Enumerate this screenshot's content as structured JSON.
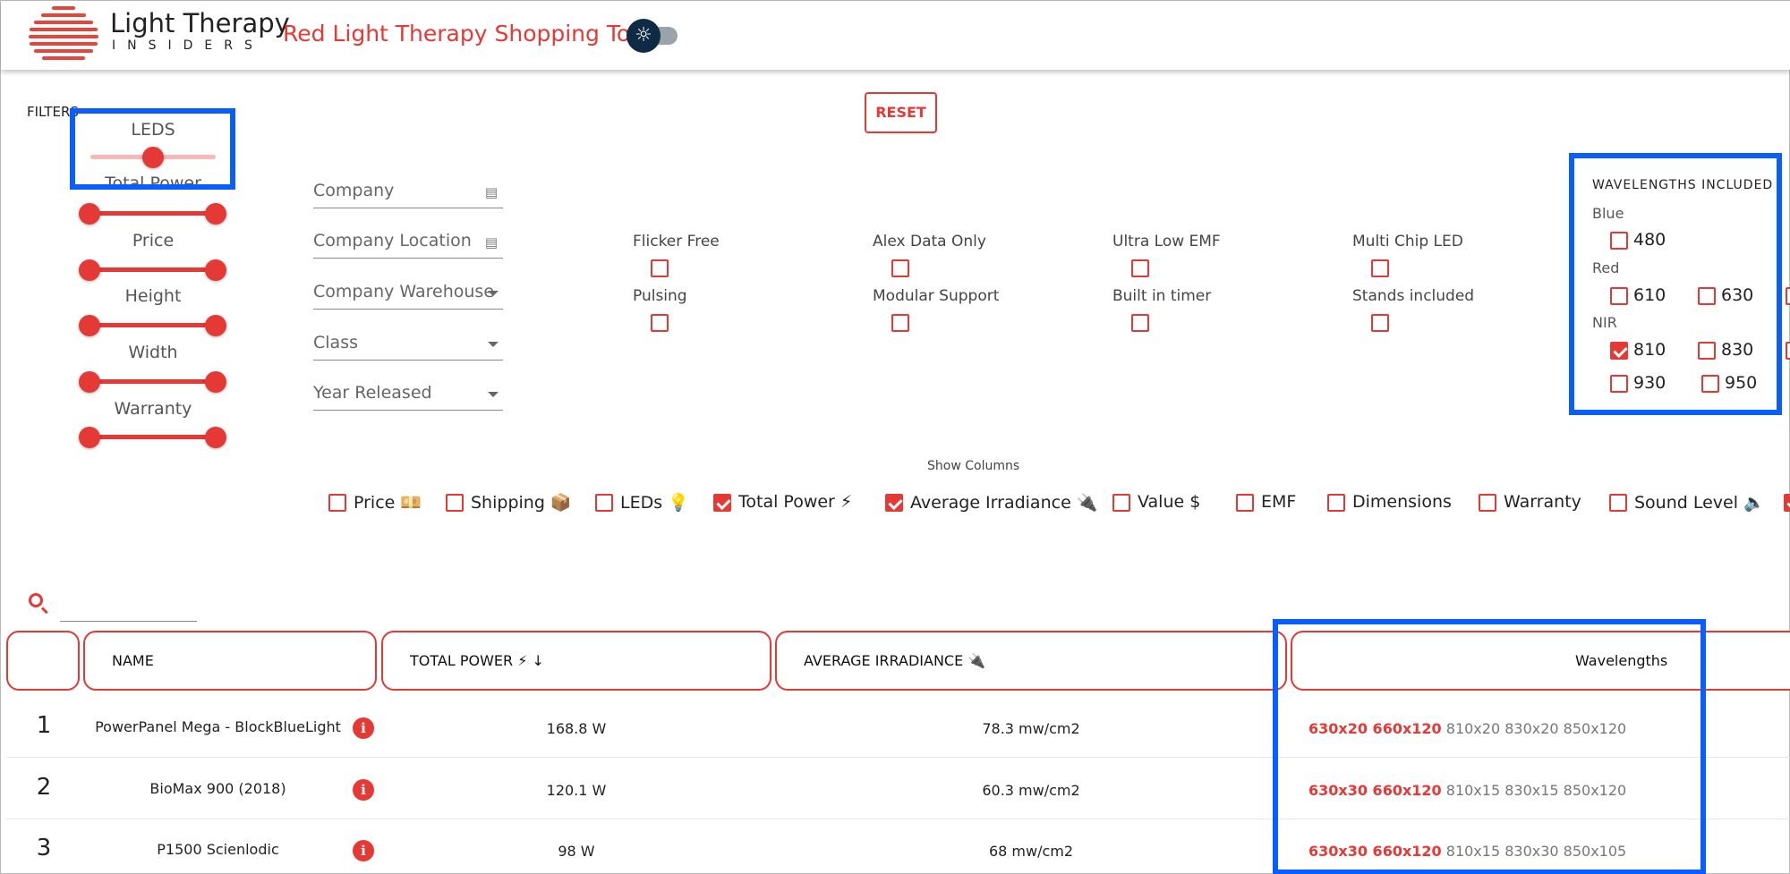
{
  "header": {
    "logo_line1": "Light Therapy",
    "logo_line2": "INSIDERS",
    "title": "Red Light Therapy Shopping Tool",
    "theme_icon": "☼"
  },
  "filters": {
    "label": "FILTERS",
    "reset": "RESET",
    "sliders": [
      "LEDS",
      "Total Power",
      "Price",
      "Height",
      "Width",
      "Warranty"
    ],
    "fields": [
      "Company",
      "Company Location",
      "Company Warehouse",
      "Class",
      "Year Released"
    ],
    "options": [
      {
        "label": "Flicker Free",
        "checked": false
      },
      {
        "label": "Alex Data Only",
        "checked": false
      },
      {
        "label": "Ultra Low EMF",
        "checked": false
      },
      {
        "label": "Multi Chip LED",
        "checked": false
      },
      {
        "label": "Pulsing",
        "checked": false
      },
      {
        "label": "Modular Support",
        "checked": false
      },
      {
        "label": "Built in timer",
        "checked": false
      },
      {
        "label": "Stands included",
        "checked": false
      }
    ]
  },
  "wavelengths": {
    "title": "WAVELENGTHS INCLUDED",
    "groups": [
      "Blue",
      "Red",
      "NIR"
    ],
    "blue": [
      {
        "v": "480",
        "checked": false
      }
    ],
    "red": [
      {
        "v": "610",
        "checked": false
      },
      {
        "v": "630",
        "checked": false
      }
    ],
    "nir": [
      {
        "v": "810",
        "checked": true
      },
      {
        "v": "830",
        "checked": false
      },
      {
        "v": "930",
        "checked": false
      },
      {
        "v": "950",
        "checked": false
      }
    ]
  },
  "show_columns": {
    "label": "Show Columns",
    "items": [
      {
        "label": "Price 💴",
        "checked": false
      },
      {
        "label": "Shipping 📦",
        "checked": false
      },
      {
        "label": "LEDs 💡",
        "checked": false
      },
      {
        "label": "Total Power ⚡",
        "checked": true
      },
      {
        "label": "Average Irradiance 🔌",
        "checked": true
      },
      {
        "label": "Value $",
        "checked": false
      },
      {
        "label": "EMF",
        "checked": false
      },
      {
        "label": "Dimensions",
        "checked": false
      },
      {
        "label": "Warranty",
        "checked": false
      },
      {
        "label": "Sound Level 🔈",
        "checked": false
      }
    ]
  },
  "table": {
    "headers": {
      "name": "NAME",
      "total_power": "TOTAL POWER ⚡ ↓",
      "avg_irradiance": "AVERAGE IRRADIANCE 🔌",
      "wavelengths": "Wavelengths"
    },
    "info_icon": "i",
    "rows": [
      {
        "num": "1",
        "name": "PowerPanel Mega - BlockBlueLight",
        "power": "168.8 W",
        "irradiance": "78.3 mw/cm2",
        "wl_red": "630x20 660x120",
        "wl_other": "810x20 830x20 850x120"
      },
      {
        "num": "2",
        "name": "BioMax 900 (2018)",
        "power": "120.1 W",
        "irradiance": "60.3 mw/cm2",
        "wl_red": "630x30 660x120",
        "wl_other": "810x15 830x15 850x120"
      },
      {
        "num": "3",
        "name": "P1500 Scienlodic",
        "power": "98 W",
        "irradiance": "68 mw/cm2",
        "wl_red": "630x30 660x120",
        "wl_other": "810x15 830x30 850x105"
      }
    ]
  },
  "colors": {
    "accent": "#e53935",
    "highlight": "#0a5eff",
    "dark": "#0f2a44"
  }
}
